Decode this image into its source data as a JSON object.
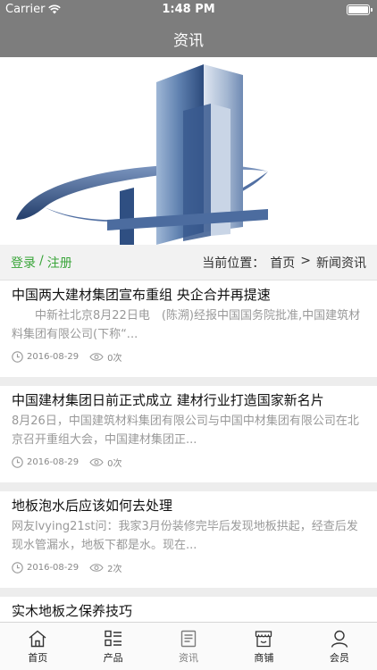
{
  "status_bar": {
    "carrier": "Carrier",
    "time": "1:48 PM"
  },
  "nav": {
    "title": "资讯"
  },
  "location": {
    "login": "登录",
    "separator": "/",
    "register": "注册",
    "prefix": "当前位置：",
    "home": "首页",
    "arrow": ">",
    "current": "新闻资讯"
  },
  "articles": [
    {
      "title": "中国两大建材集团宣布重组 央企合并再提速",
      "summary": "　　中新社北京8月22日电　(陈溯)经报中国国务院批准,中国建筑材料集团有限公司(下称“...",
      "date": "2016-08-29",
      "views": "0次"
    },
    {
      "title": "中国建材集团日前正式成立 建材行业打造国家新名片",
      "summary": "8月26日，中国建筑材料集团有限公司与中国中材集团有限公司在北京召开重组大会，中国建材集团正...",
      "date": "2016-08-29",
      "views": "0次"
    },
    {
      "title": "地板泡水后应该如何去处理",
      "summary": "网友lvying21st问：我家3月份装修完毕后发现地板拱起，经查后发现水管漏水，地板下都是水。现在...",
      "date": "2016-08-29",
      "views": "2次"
    },
    {
      "title": "实木地板之保养技巧"
    }
  ],
  "tabs": [
    {
      "label": "首页",
      "icon": "home-icon"
    },
    {
      "label": "产品",
      "icon": "grid-list-icon"
    },
    {
      "label": "资讯",
      "icon": "document-icon"
    },
    {
      "label": "商铺",
      "icon": "shop-icon"
    },
    {
      "label": "会员",
      "icon": "user-icon"
    }
  ],
  "colors": {
    "bar": "#7d7d7d",
    "accent_green": "#3aa53a",
    "logo_blue": "#3f6199"
  }
}
